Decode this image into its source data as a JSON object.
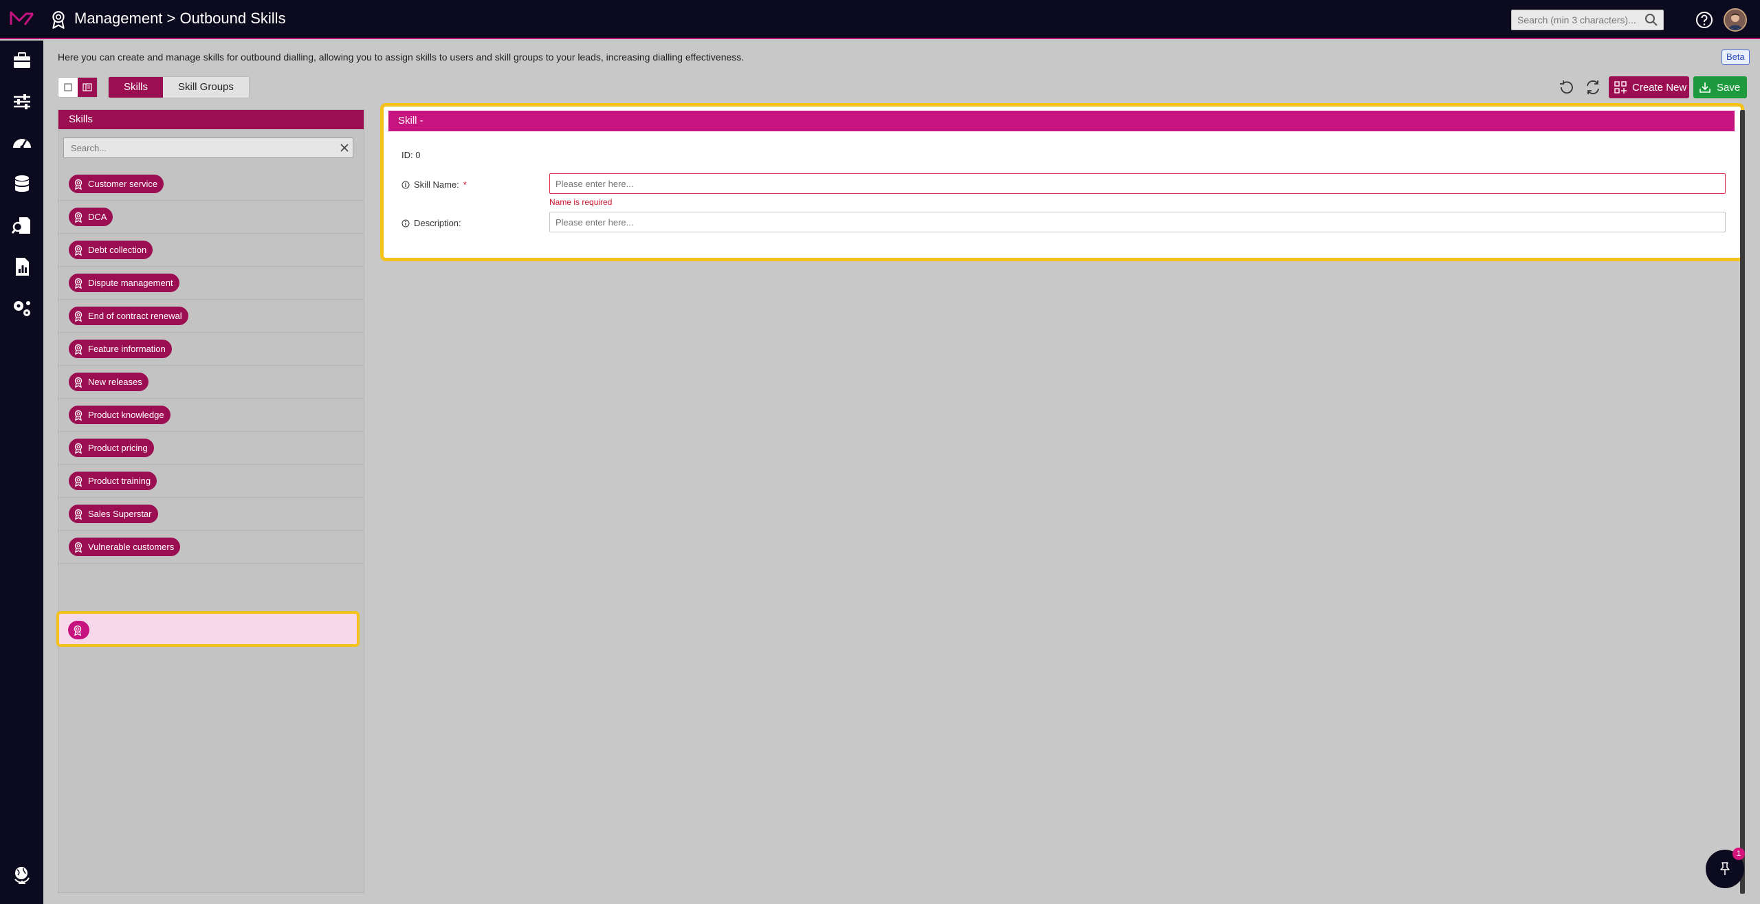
{
  "header": {
    "title": "Management > Outbound Skills",
    "search_placeholder": "Search (min 3 characters)..."
  },
  "page": {
    "description": "Here you can create and manage skills for outbound dialling, allowing you to assign skills to users and skill groups to your leads, increasing dialling effectiveness.",
    "beta_label": "Beta"
  },
  "tabs": [
    {
      "label": "Skills",
      "active": true
    },
    {
      "label": "Skill Groups",
      "active": false
    }
  ],
  "toolbar": {
    "create_label": "Create New",
    "save_label": "Save"
  },
  "skills_panel": {
    "title": "Skills",
    "search_placeholder": "Search...",
    "items": [
      "Customer service",
      "DCA",
      "Debt collection",
      "Dispute management",
      "End of contract renewal",
      "Feature information",
      "New releases",
      "Product knowledge",
      "Product pricing",
      "Product training",
      "Sales Superstar",
      "Vulnerable customers"
    ]
  },
  "detail": {
    "header": "Skill -",
    "id_text": "ID: 0",
    "name_label": "Skill Name:",
    "name_required": "*",
    "name_placeholder": "Please enter here...",
    "name_error": "Name is required",
    "description_label": "Description:",
    "description_placeholder": "Please enter here..."
  },
  "notifications": {
    "pin_count": "1"
  },
  "colors": {
    "brand": "#9c0e52",
    "accent": "#c7137f",
    "save": "#1e9a3e",
    "highlight": "#f5c21b",
    "nav_bg": "#0b0a1e"
  }
}
